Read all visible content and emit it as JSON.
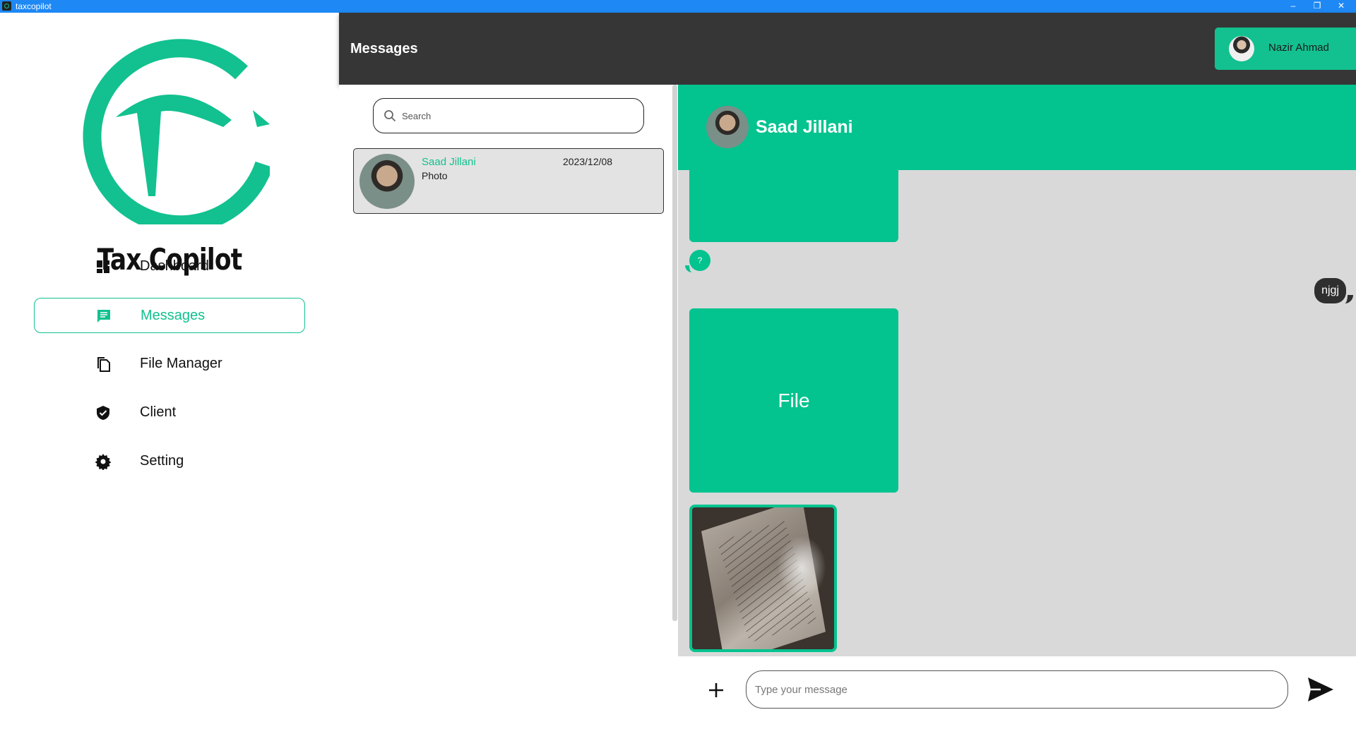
{
  "window": {
    "title": "taxcopilot",
    "minimize": "–",
    "restore": "❐",
    "close": "✕"
  },
  "brand": {
    "name": "Tax Copilot",
    "accent": "#12c18f"
  },
  "nav": {
    "items": [
      {
        "label": "Dashboard",
        "icon": "dashboard-icon",
        "active": false
      },
      {
        "label": "Messages",
        "icon": "message-icon",
        "active": true
      },
      {
        "label": "File Manager",
        "icon": "files-icon",
        "active": false
      },
      {
        "label": "Client",
        "icon": "shield-check-icon",
        "active": false
      },
      {
        "label": "Setting",
        "icon": "gear-icon",
        "active": false
      }
    ]
  },
  "header": {
    "title": "Messages",
    "user": {
      "name": "Nazir Ahmad"
    }
  },
  "conversations": {
    "search_placeholder": "Search",
    "items": [
      {
        "name": "Saad Jillani",
        "date": "2023/12/08",
        "preview": "Photo"
      }
    ]
  },
  "chat": {
    "contact_name": "Saad Jillani",
    "messages": [
      {
        "type": "tile",
        "from": "contact"
      },
      {
        "type": "text",
        "from": "contact",
        "text": "?"
      },
      {
        "type": "text",
        "from": "me",
        "text": "njgj"
      },
      {
        "type": "file",
        "from": "contact",
        "label": "File"
      },
      {
        "type": "photo",
        "from": "contact"
      }
    ],
    "composer": {
      "placeholder": "Type your message"
    }
  }
}
